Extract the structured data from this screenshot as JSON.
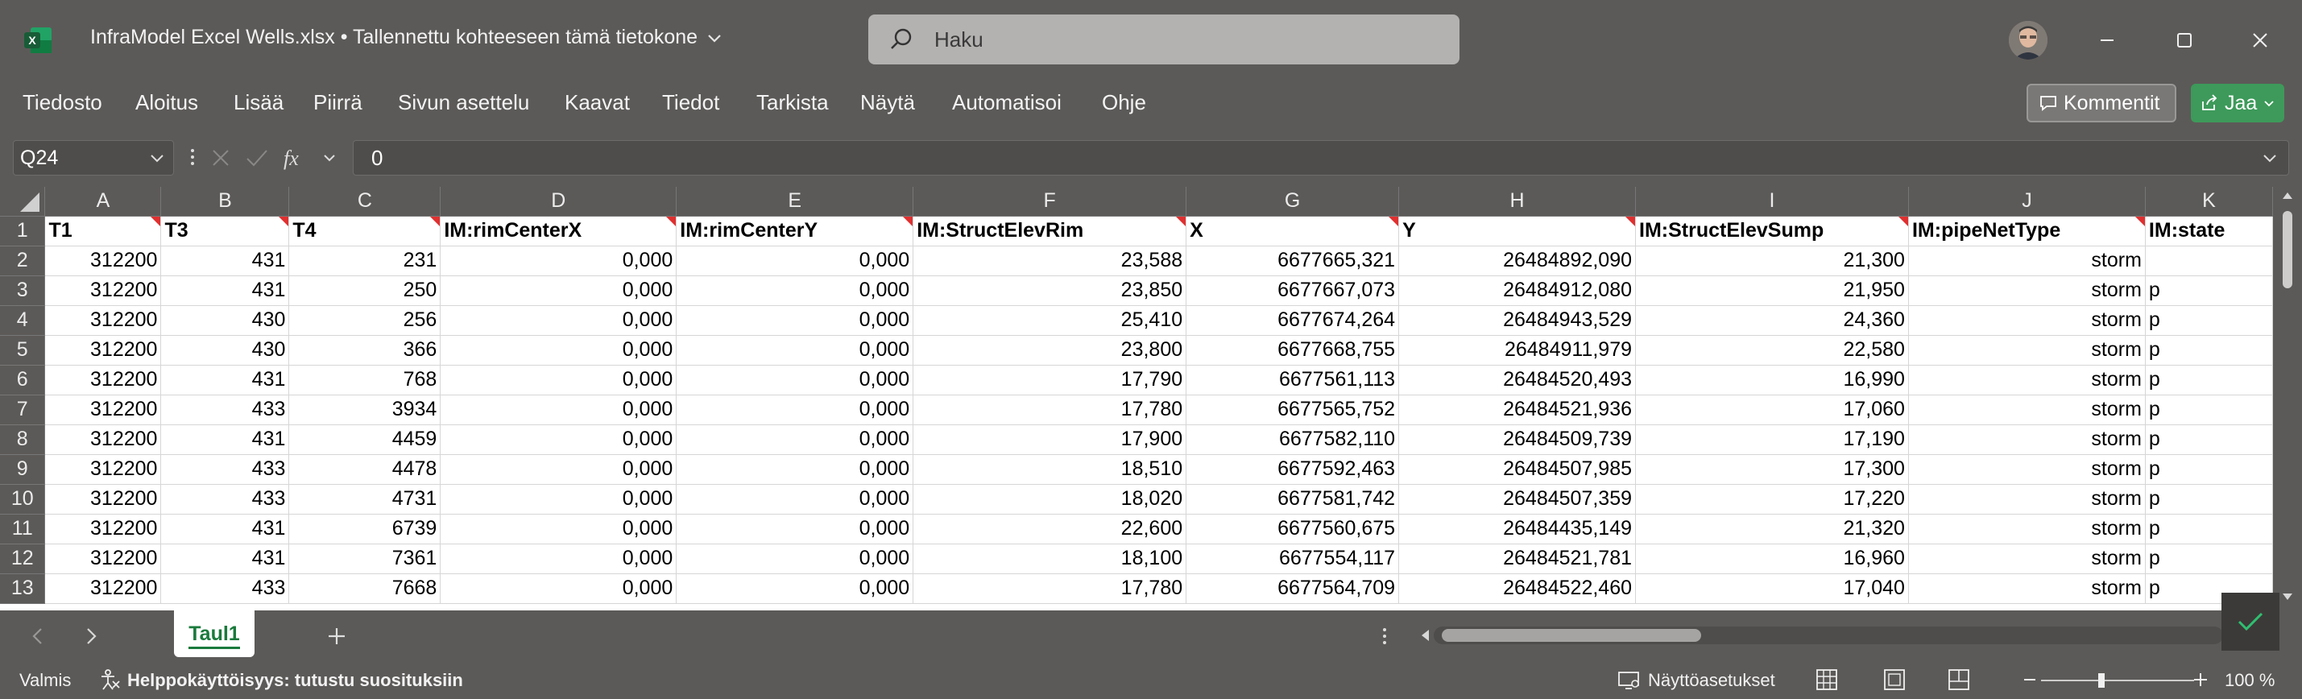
{
  "titlebar": {
    "doc_title": "InfraModel Excel Wells.xlsx • Tallennettu kohteeseen tämä tietokone",
    "search_placeholder": "Haku"
  },
  "menu": {
    "items": [
      "Tiedosto",
      "Aloitus",
      "Lisää",
      "Piirrä",
      "Sivun asettelu",
      "Kaavat",
      "Tiedot",
      "Tarkista",
      "Näytä",
      "Automatisoi",
      "Ohje"
    ],
    "comments_label": "Kommentit",
    "share_label": "Jaa"
  },
  "formula": {
    "name_box": "Q24",
    "value": "0"
  },
  "sheet": {
    "columns": [
      "A",
      "B",
      "C",
      "D",
      "E",
      "F",
      "G",
      "H",
      "I",
      "J",
      "K"
    ],
    "row_numbers": [
      "1",
      "2",
      "3",
      "4",
      "5",
      "6",
      "7",
      "8",
      "9",
      "10",
      "11",
      "12",
      "13"
    ],
    "headers": [
      "T1",
      "T3",
      "T4",
      "IM:rimCenterX",
      "IM:rimCenterY",
      "IM:StructElevRim",
      "X",
      "Y",
      "IM:StructElevSump",
      "IM:pipeNetType",
      "IM:state"
    ],
    "rows": [
      [
        "312200",
        "431",
        "231",
        "0,000",
        "0,000",
        "23,588",
        "6677665,321",
        "26484892,090",
        "21,300",
        "storm",
        ""
      ],
      [
        "312200",
        "431",
        "250",
        "0,000",
        "0,000",
        "23,850",
        "6677667,073",
        "26484912,080",
        "21,950",
        "storm",
        "p"
      ],
      [
        "312200",
        "430",
        "256",
        "0,000",
        "0,000",
        "25,410",
        "6677674,264",
        "26484943,529",
        "24,360",
        "storm",
        "p"
      ],
      [
        "312200",
        "430",
        "366",
        "0,000",
        "0,000",
        "23,800",
        "6677668,755",
        "26484911,979",
        "22,580",
        "storm",
        "p"
      ],
      [
        "312200",
        "431",
        "768",
        "0,000",
        "0,000",
        "17,790",
        "6677561,113",
        "26484520,493",
        "16,990",
        "storm",
        "p"
      ],
      [
        "312200",
        "433",
        "3934",
        "0,000",
        "0,000",
        "17,780",
        "6677565,752",
        "26484521,936",
        "17,060",
        "storm",
        "p"
      ],
      [
        "312200",
        "431",
        "4459",
        "0,000",
        "0,000",
        "17,900",
        "6677582,110",
        "26484509,739",
        "17,190",
        "storm",
        "p"
      ],
      [
        "312200",
        "433",
        "4478",
        "0,000",
        "0,000",
        "18,510",
        "6677592,463",
        "26484507,985",
        "17,300",
        "storm",
        "p"
      ],
      [
        "312200",
        "433",
        "4731",
        "0,000",
        "0,000",
        "18,020",
        "6677581,742",
        "26484507,359",
        "17,220",
        "storm",
        "p"
      ],
      [
        "312200",
        "431",
        "6739",
        "0,000",
        "0,000",
        "22,600",
        "6677560,675",
        "26484435,149",
        "21,320",
        "storm",
        "p"
      ],
      [
        "312200",
        "431",
        "7361",
        "0,000",
        "0,000",
        "18,100",
        "6677554,117",
        "26484521,781",
        "16,960",
        "storm",
        "p"
      ],
      [
        "312200",
        "433",
        "7668",
        "0,000",
        "0,000",
        "17,780",
        "6677564,709",
        "26484522,460",
        "17,040",
        "storm",
        "p"
      ]
    ],
    "tab_name": "Taul1"
  },
  "status": {
    "ready": "Valmis",
    "accessibility": "Helppokäyttöisyys: tutustu suosituksiin",
    "display_settings": "Näyttöasetukset",
    "zoom": "100 %"
  },
  "colors": {
    "chrome": "#5c5a58",
    "share_green": "#3d9a5a",
    "note_red": "#e03030"
  }
}
